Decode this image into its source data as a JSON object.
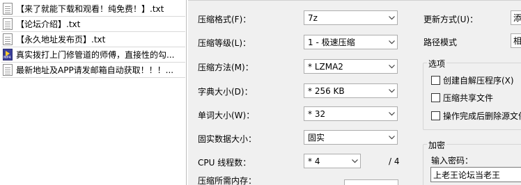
{
  "files": [
    {
      "name": "【来了就能下载和观看！纯免费！】.txt",
      "icon": "txt-file-icon"
    },
    {
      "name": "【论坛介绍】.txt",
      "icon": "txt-file-icon"
    },
    {
      "name": "【永久地址发布页】.txt",
      "icon": "txt-file-icon"
    },
    {
      "name": "真实拨打上门修管道的师傅，直接性的勾...",
      "icon": "mp4-file-icon"
    },
    {
      "name": "最新地址及APP请发邮箱自动获取！！！...",
      "icon": "txt-file-icon"
    }
  ],
  "settings": {
    "format_label": "压缩格式(F)：",
    "format_value": "7z",
    "level_label": "压缩等级(L)：",
    "level_value": "1 - 极速压缩",
    "method_label": "压缩方法(M)：",
    "method_value": "* LZMA2",
    "dict_label": "字典大小(D)：",
    "dict_value": "* 256 KB",
    "word_label": "单词大小(W)：",
    "word_value": "* 32",
    "solid_label": "固实数据大小：",
    "solid_value": "固实",
    "threads_label": "CPU 线程数：",
    "threads_value": "* 4",
    "threads_max": "/ 4",
    "memory_label": "压缩所需内存："
  },
  "right": {
    "update_label": "更新方式(U)：",
    "update_value": "添",
    "path_label": "路径模式",
    "path_value": "相",
    "options_title": "选项",
    "opt_sfx": "创建自解压程序(X)",
    "opt_shared": "压缩共享文件",
    "opt_delete": "操作完成后删除源文件",
    "encrypt_title": "加密",
    "password_label": "输入密码：",
    "password_value": "上老王论坛当老王"
  },
  "colors": {
    "dialog_bg": "#f0f0f0",
    "border": "#adadad"
  }
}
